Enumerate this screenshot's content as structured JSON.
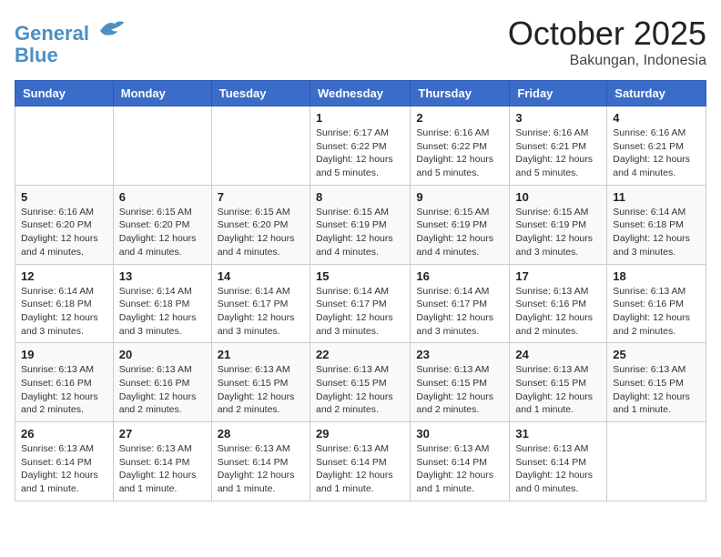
{
  "header": {
    "logo_line1": "General",
    "logo_line2": "Blue",
    "month": "October 2025",
    "location": "Bakungan, Indonesia"
  },
  "weekdays": [
    "Sunday",
    "Monday",
    "Tuesday",
    "Wednesday",
    "Thursday",
    "Friday",
    "Saturday"
  ],
  "weeks": [
    [
      {
        "day": "",
        "info": ""
      },
      {
        "day": "",
        "info": ""
      },
      {
        "day": "",
        "info": ""
      },
      {
        "day": "1",
        "info": "Sunrise: 6:17 AM\nSunset: 6:22 PM\nDaylight: 12 hours\nand 5 minutes."
      },
      {
        "day": "2",
        "info": "Sunrise: 6:16 AM\nSunset: 6:22 PM\nDaylight: 12 hours\nand 5 minutes."
      },
      {
        "day": "3",
        "info": "Sunrise: 6:16 AM\nSunset: 6:21 PM\nDaylight: 12 hours\nand 5 minutes."
      },
      {
        "day": "4",
        "info": "Sunrise: 6:16 AM\nSunset: 6:21 PM\nDaylight: 12 hours\nand 4 minutes."
      }
    ],
    [
      {
        "day": "5",
        "info": "Sunrise: 6:16 AM\nSunset: 6:20 PM\nDaylight: 12 hours\nand 4 minutes."
      },
      {
        "day": "6",
        "info": "Sunrise: 6:15 AM\nSunset: 6:20 PM\nDaylight: 12 hours\nand 4 minutes."
      },
      {
        "day": "7",
        "info": "Sunrise: 6:15 AM\nSunset: 6:20 PM\nDaylight: 12 hours\nand 4 minutes."
      },
      {
        "day": "8",
        "info": "Sunrise: 6:15 AM\nSunset: 6:19 PM\nDaylight: 12 hours\nand 4 minutes."
      },
      {
        "day": "9",
        "info": "Sunrise: 6:15 AM\nSunset: 6:19 PM\nDaylight: 12 hours\nand 4 minutes."
      },
      {
        "day": "10",
        "info": "Sunrise: 6:15 AM\nSunset: 6:19 PM\nDaylight: 12 hours\nand 3 minutes."
      },
      {
        "day": "11",
        "info": "Sunrise: 6:14 AM\nSunset: 6:18 PM\nDaylight: 12 hours\nand 3 minutes."
      }
    ],
    [
      {
        "day": "12",
        "info": "Sunrise: 6:14 AM\nSunset: 6:18 PM\nDaylight: 12 hours\nand 3 minutes."
      },
      {
        "day": "13",
        "info": "Sunrise: 6:14 AM\nSunset: 6:18 PM\nDaylight: 12 hours\nand 3 minutes."
      },
      {
        "day": "14",
        "info": "Sunrise: 6:14 AM\nSunset: 6:17 PM\nDaylight: 12 hours\nand 3 minutes."
      },
      {
        "day": "15",
        "info": "Sunrise: 6:14 AM\nSunset: 6:17 PM\nDaylight: 12 hours\nand 3 minutes."
      },
      {
        "day": "16",
        "info": "Sunrise: 6:14 AM\nSunset: 6:17 PM\nDaylight: 12 hours\nand 3 minutes."
      },
      {
        "day": "17",
        "info": "Sunrise: 6:13 AM\nSunset: 6:16 PM\nDaylight: 12 hours\nand 2 minutes."
      },
      {
        "day": "18",
        "info": "Sunrise: 6:13 AM\nSunset: 6:16 PM\nDaylight: 12 hours\nand 2 minutes."
      }
    ],
    [
      {
        "day": "19",
        "info": "Sunrise: 6:13 AM\nSunset: 6:16 PM\nDaylight: 12 hours\nand 2 minutes."
      },
      {
        "day": "20",
        "info": "Sunrise: 6:13 AM\nSunset: 6:16 PM\nDaylight: 12 hours\nand 2 minutes."
      },
      {
        "day": "21",
        "info": "Sunrise: 6:13 AM\nSunset: 6:15 PM\nDaylight: 12 hours\nand 2 minutes."
      },
      {
        "day": "22",
        "info": "Sunrise: 6:13 AM\nSunset: 6:15 PM\nDaylight: 12 hours\nand 2 minutes."
      },
      {
        "day": "23",
        "info": "Sunrise: 6:13 AM\nSunset: 6:15 PM\nDaylight: 12 hours\nand 2 minutes."
      },
      {
        "day": "24",
        "info": "Sunrise: 6:13 AM\nSunset: 6:15 PM\nDaylight: 12 hours\nand 1 minute."
      },
      {
        "day": "25",
        "info": "Sunrise: 6:13 AM\nSunset: 6:15 PM\nDaylight: 12 hours\nand 1 minute."
      }
    ],
    [
      {
        "day": "26",
        "info": "Sunrise: 6:13 AM\nSunset: 6:14 PM\nDaylight: 12 hours\nand 1 minute."
      },
      {
        "day": "27",
        "info": "Sunrise: 6:13 AM\nSunset: 6:14 PM\nDaylight: 12 hours\nand 1 minute."
      },
      {
        "day": "28",
        "info": "Sunrise: 6:13 AM\nSunset: 6:14 PM\nDaylight: 12 hours\nand 1 minute."
      },
      {
        "day": "29",
        "info": "Sunrise: 6:13 AM\nSunset: 6:14 PM\nDaylight: 12 hours\nand 1 minute."
      },
      {
        "day": "30",
        "info": "Sunrise: 6:13 AM\nSunset: 6:14 PM\nDaylight: 12 hours\nand 1 minute."
      },
      {
        "day": "31",
        "info": "Sunrise: 6:13 AM\nSunset: 6:14 PM\nDaylight: 12 hours\nand 0 minutes."
      },
      {
        "day": "",
        "info": ""
      }
    ]
  ]
}
